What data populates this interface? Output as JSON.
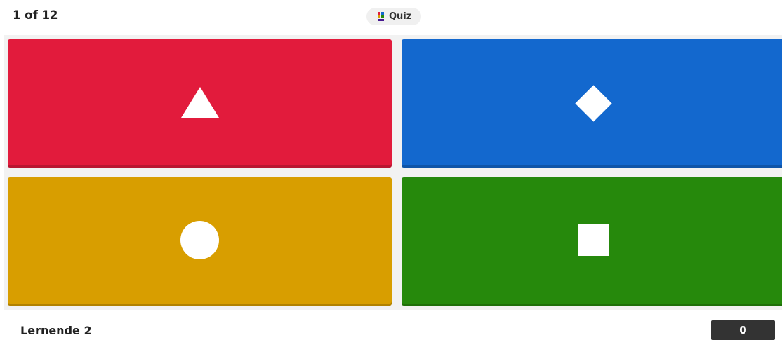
{
  "header": {
    "question_counter": "1 of 12",
    "question_type": {
      "label": "Quiz",
      "icon": "quiz-blocks-icon"
    }
  },
  "answers": [
    {
      "shape": "triangle-icon",
      "color": "#e21b3c"
    },
    {
      "shape": "diamond-icon",
      "color": "#1368ce"
    },
    {
      "shape": "circle-icon",
      "color": "#d89e00"
    },
    {
      "shape": "square-icon",
      "color": "#26890c"
    }
  ],
  "footer": {
    "player_name": "Lernende 2",
    "score": "0"
  }
}
